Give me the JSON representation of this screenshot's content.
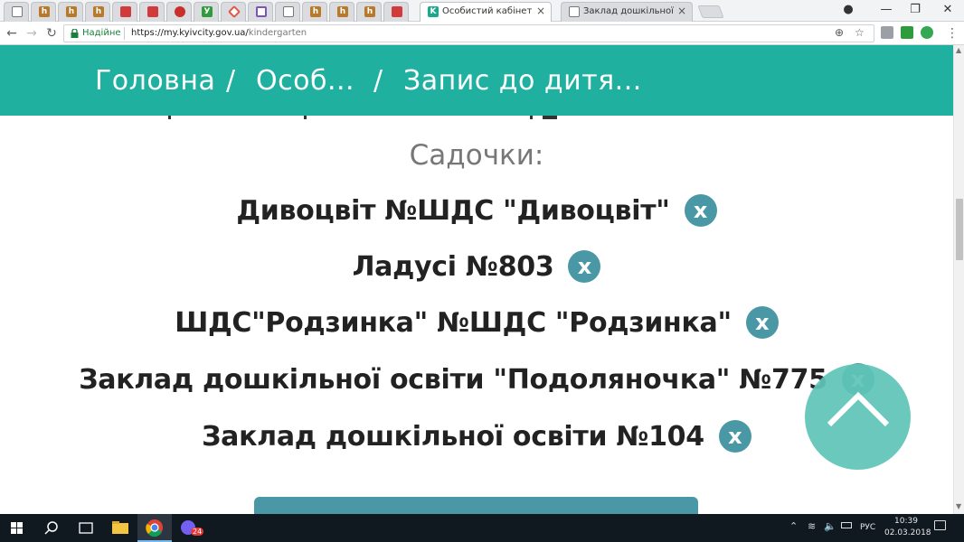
{
  "browser": {
    "active_tab_title": "Особистий кабінет киян",
    "second_tab_title": "Заклад дошкільної освіти",
    "security_label": "Надійне",
    "url_host": "https://my.kyivcity.gov.ua/",
    "url_path": "kindergarten",
    "pinned_tab_letters": [
      "",
      "h",
      "h",
      "h",
      "",
      "",
      "",
      "У",
      "",
      "",
      "",
      "h",
      "h",
      "h",
      ""
    ]
  },
  "header": {
    "breadcrumb": [
      "Головна",
      "/",
      "Особ...",
      "/",
      "Запис до дитя..."
    ]
  },
  "main": {
    "section_title": "Садочки:",
    "kindergartens": [
      {
        "name": "Дивоцвіт №ШДС \"Дивоцвіт\"",
        "remove": "x"
      },
      {
        "name": "Ладусі №803",
        "remove": "x"
      },
      {
        "name": "ШДС\"Родзинка\" №ШДС \"Родзинка\"",
        "remove": "x"
      },
      {
        "name": "Заклад дошкільної освіти \"Подоляночка\" №775",
        "remove": "x"
      },
      {
        "name": "Заклад дошкільної освіти №104",
        "remove": "x"
      }
    ]
  },
  "taskbar": {
    "language": "РУС",
    "time": "10:39",
    "date": "02.03.2018",
    "viber_badge": "24"
  },
  "colors": {
    "header": "#1fb0a0",
    "remove_button": "#4a98a6",
    "scroll_top_button": "#5fc5b7"
  }
}
